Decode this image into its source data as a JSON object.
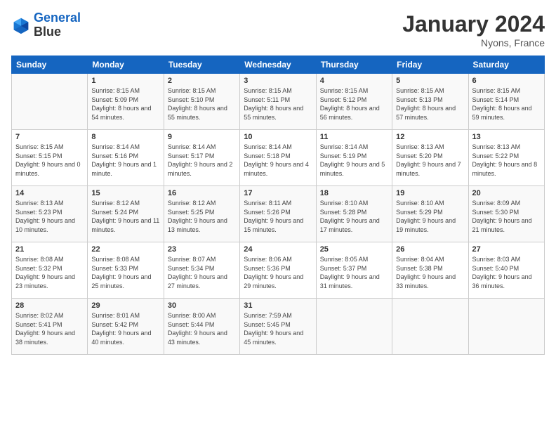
{
  "logo": {
    "line1": "General",
    "line2": "Blue"
  },
  "title": "January 2024",
  "location": "Nyons, France",
  "days_header": [
    "Sunday",
    "Monday",
    "Tuesday",
    "Wednesday",
    "Thursday",
    "Friday",
    "Saturday"
  ],
  "weeks": [
    [
      {
        "day": "",
        "sunrise": "",
        "sunset": "",
        "daylight": ""
      },
      {
        "day": "1",
        "sunrise": "Sunrise: 8:15 AM",
        "sunset": "Sunset: 5:09 PM",
        "daylight": "Daylight: 8 hours and 54 minutes."
      },
      {
        "day": "2",
        "sunrise": "Sunrise: 8:15 AM",
        "sunset": "Sunset: 5:10 PM",
        "daylight": "Daylight: 8 hours and 55 minutes."
      },
      {
        "day": "3",
        "sunrise": "Sunrise: 8:15 AM",
        "sunset": "Sunset: 5:11 PM",
        "daylight": "Daylight: 8 hours and 55 minutes."
      },
      {
        "day": "4",
        "sunrise": "Sunrise: 8:15 AM",
        "sunset": "Sunset: 5:12 PM",
        "daylight": "Daylight: 8 hours and 56 minutes."
      },
      {
        "day": "5",
        "sunrise": "Sunrise: 8:15 AM",
        "sunset": "Sunset: 5:13 PM",
        "daylight": "Daylight: 8 hours and 57 minutes."
      },
      {
        "day": "6",
        "sunrise": "Sunrise: 8:15 AM",
        "sunset": "Sunset: 5:14 PM",
        "daylight": "Daylight: 8 hours and 59 minutes."
      }
    ],
    [
      {
        "day": "7",
        "sunrise": "Sunrise: 8:15 AM",
        "sunset": "Sunset: 5:15 PM",
        "daylight": "Daylight: 9 hours and 0 minutes."
      },
      {
        "day": "8",
        "sunrise": "Sunrise: 8:14 AM",
        "sunset": "Sunset: 5:16 PM",
        "daylight": "Daylight: 9 hours and 1 minute."
      },
      {
        "day": "9",
        "sunrise": "Sunrise: 8:14 AM",
        "sunset": "Sunset: 5:17 PM",
        "daylight": "Daylight: 9 hours and 2 minutes."
      },
      {
        "day": "10",
        "sunrise": "Sunrise: 8:14 AM",
        "sunset": "Sunset: 5:18 PM",
        "daylight": "Daylight: 9 hours and 4 minutes."
      },
      {
        "day": "11",
        "sunrise": "Sunrise: 8:14 AM",
        "sunset": "Sunset: 5:19 PM",
        "daylight": "Daylight: 9 hours and 5 minutes."
      },
      {
        "day": "12",
        "sunrise": "Sunrise: 8:13 AM",
        "sunset": "Sunset: 5:20 PM",
        "daylight": "Daylight: 9 hours and 7 minutes."
      },
      {
        "day": "13",
        "sunrise": "Sunrise: 8:13 AM",
        "sunset": "Sunset: 5:22 PM",
        "daylight": "Daylight: 9 hours and 8 minutes."
      }
    ],
    [
      {
        "day": "14",
        "sunrise": "Sunrise: 8:13 AM",
        "sunset": "Sunset: 5:23 PM",
        "daylight": "Daylight: 9 hours and 10 minutes."
      },
      {
        "day": "15",
        "sunrise": "Sunrise: 8:12 AM",
        "sunset": "Sunset: 5:24 PM",
        "daylight": "Daylight: 9 hours and 11 minutes."
      },
      {
        "day": "16",
        "sunrise": "Sunrise: 8:12 AM",
        "sunset": "Sunset: 5:25 PM",
        "daylight": "Daylight: 9 hours and 13 minutes."
      },
      {
        "day": "17",
        "sunrise": "Sunrise: 8:11 AM",
        "sunset": "Sunset: 5:26 PM",
        "daylight": "Daylight: 9 hours and 15 minutes."
      },
      {
        "day": "18",
        "sunrise": "Sunrise: 8:10 AM",
        "sunset": "Sunset: 5:28 PM",
        "daylight": "Daylight: 9 hours and 17 minutes."
      },
      {
        "day": "19",
        "sunrise": "Sunrise: 8:10 AM",
        "sunset": "Sunset: 5:29 PM",
        "daylight": "Daylight: 9 hours and 19 minutes."
      },
      {
        "day": "20",
        "sunrise": "Sunrise: 8:09 AM",
        "sunset": "Sunset: 5:30 PM",
        "daylight": "Daylight: 9 hours and 21 minutes."
      }
    ],
    [
      {
        "day": "21",
        "sunrise": "Sunrise: 8:08 AM",
        "sunset": "Sunset: 5:32 PM",
        "daylight": "Daylight: 9 hours and 23 minutes."
      },
      {
        "day": "22",
        "sunrise": "Sunrise: 8:08 AM",
        "sunset": "Sunset: 5:33 PM",
        "daylight": "Daylight: 9 hours and 25 minutes."
      },
      {
        "day": "23",
        "sunrise": "Sunrise: 8:07 AM",
        "sunset": "Sunset: 5:34 PM",
        "daylight": "Daylight: 9 hours and 27 minutes."
      },
      {
        "day": "24",
        "sunrise": "Sunrise: 8:06 AM",
        "sunset": "Sunset: 5:36 PM",
        "daylight": "Daylight: 9 hours and 29 minutes."
      },
      {
        "day": "25",
        "sunrise": "Sunrise: 8:05 AM",
        "sunset": "Sunset: 5:37 PM",
        "daylight": "Daylight: 9 hours and 31 minutes."
      },
      {
        "day": "26",
        "sunrise": "Sunrise: 8:04 AM",
        "sunset": "Sunset: 5:38 PM",
        "daylight": "Daylight: 9 hours and 33 minutes."
      },
      {
        "day": "27",
        "sunrise": "Sunrise: 8:03 AM",
        "sunset": "Sunset: 5:40 PM",
        "daylight": "Daylight: 9 hours and 36 minutes."
      }
    ],
    [
      {
        "day": "28",
        "sunrise": "Sunrise: 8:02 AM",
        "sunset": "Sunset: 5:41 PM",
        "daylight": "Daylight: 9 hours and 38 minutes."
      },
      {
        "day": "29",
        "sunrise": "Sunrise: 8:01 AM",
        "sunset": "Sunset: 5:42 PM",
        "daylight": "Daylight: 9 hours and 40 minutes."
      },
      {
        "day": "30",
        "sunrise": "Sunrise: 8:00 AM",
        "sunset": "Sunset: 5:44 PM",
        "daylight": "Daylight: 9 hours and 43 minutes."
      },
      {
        "day": "31",
        "sunrise": "Sunrise: 7:59 AM",
        "sunset": "Sunset: 5:45 PM",
        "daylight": "Daylight: 9 hours and 45 minutes."
      },
      {
        "day": "",
        "sunrise": "",
        "sunset": "",
        "daylight": ""
      },
      {
        "day": "",
        "sunrise": "",
        "sunset": "",
        "daylight": ""
      },
      {
        "day": "",
        "sunrise": "",
        "sunset": "",
        "daylight": ""
      }
    ]
  ]
}
